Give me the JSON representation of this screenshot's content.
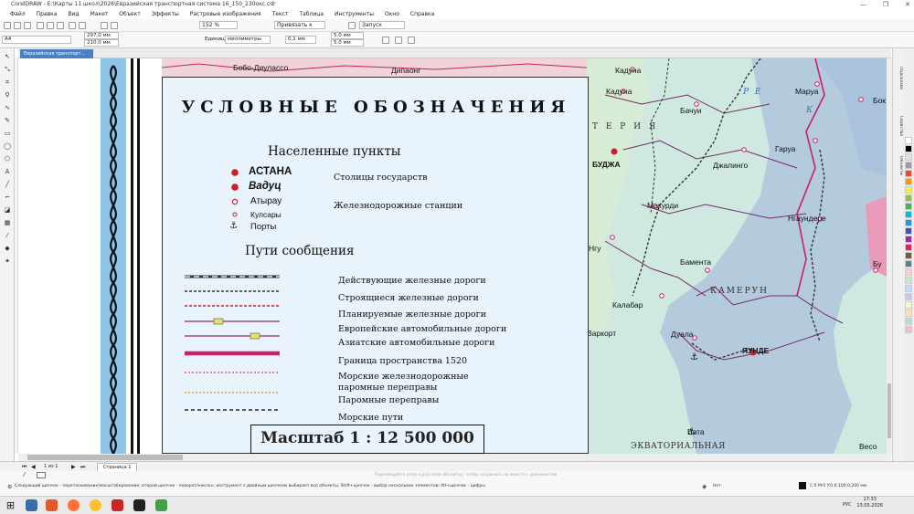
{
  "app": {
    "title": "CorelDRAW - E:\\Карты 11 школ\\2026\\Евразийская транспортная система 16_150_230окс.cdr",
    "window_controls": [
      "—",
      "❐",
      "✕"
    ]
  },
  "menu": [
    "Файл",
    "Правка",
    "Вид",
    "Макет",
    "Объект",
    "Эффекты",
    "Растровые изображения",
    "Текст",
    "Таблица",
    "Инструменты",
    "Окно",
    "Справка"
  ],
  "toolbar": {
    "zoom": "152 %",
    "snap": "Привязать к",
    "launch": "Запуск",
    "page_size": "A4",
    "width": "297,0 мм",
    "height": "210,0 мм",
    "units_label": "Единицы:",
    "units": "миллиметры",
    "nudge": "0,1 мм",
    "dup_x": "5,0 мм",
    "dup_y": "5,0 мм"
  },
  "document_tab": "Евразийская транспорт...",
  "right_dock_tabs": [
    "Подсказки",
    "Свойства",
    "Объекты"
  ],
  "legend": {
    "title": "УСЛОВНЫЕ ОБОЗНАЧЕНИЯ",
    "settlements_heading": "Населенные пункты",
    "cities": [
      "АСТАНА",
      "Вадуц",
      "Атырау",
      "Кулсары",
      "Порты"
    ],
    "capitals_label": "Столицы государств",
    "stations_label": "Железнодорожные станции",
    "routes_heading": "Пути сообщения",
    "routes": [
      "Действующие железные дороги",
      "Строящиеся железные дороги",
      "Планируемые железные дороги",
      "Европейские автомобильные дороги",
      "Азиатские автомобильные дороги",
      "Граница пространства 1520",
      "Морские железнодорожные",
      "паромные переправы",
      "Паромные переправы",
      "Морские пути"
    ],
    "scale": "Масштаб 1 :  12 500 000"
  },
  "map": {
    "labels": [
      "Бобо-Диулассо",
      "Дипаонг",
      "Кадуна",
      "Кадуна",
      "Маруа",
      "Бок",
      "Бачуи",
      "Гаруа",
      "Джалинго",
      "БУДЖА",
      "Макурди",
      "Нгаундере",
      "Бамента",
      "Калабар",
      "Бамента",
      "КАМЕРУН",
      "Дуала",
      "ЯУНДЕ",
      "Бата",
      "ЭКВАТОРИАЛЬНАЯ",
      "Весо",
      "Бу",
      "Варкорт",
      "Нгу",
      "Т Е Р И Я",
      "Р Е",
      "К"
    ]
  },
  "page_nav": {
    "counter": "1  из  1",
    "page_tab": "Страница 1"
  },
  "status": {
    "hint": "Следующий щелчок - перетаскивание/масштабирование; второй щелчок - поворот/наклон; инструмент с двойным щелчком выбирает все объекты; Shift+щелчок - выбор нескольких элементов; Alt+щелчок - цифры",
    "center_hint": "Перемещайте упор курса (или объекты), чтобы сохранить их вместе с документом",
    "fill": "Нет",
    "color": "C:0 M:0 Y:0 K:100  0,200 мм"
  },
  "taskbar": {
    "lang": "РУС",
    "time": "17:33",
    "date": "13.05.2026"
  },
  "colors": {
    "ornament_blue": "#8ec5ea",
    "legend_bg": "#e8f3fb",
    "map_blue": "#b4cadd",
    "map_green": "#cfe9e0",
    "map_pink": "#e89ab8",
    "border_magenta": "#c8206a",
    "accent": "#4a7fc1"
  }
}
